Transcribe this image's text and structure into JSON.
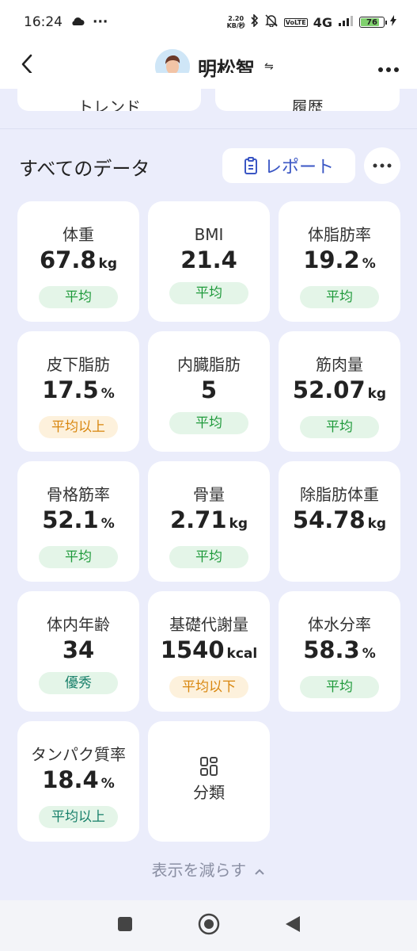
{
  "status_bar": {
    "time": "16:24",
    "net_speed_top": "2.20",
    "net_speed_bottom": "KB/秒",
    "network": "4G",
    "lte": "VoLTE",
    "battery": "76"
  },
  "header": {
    "user_name": "明松智",
    "switch_symbol": "⇋"
  },
  "top_cards": {
    "trend_label": "トレンド",
    "history_label": "履歴"
  },
  "section": {
    "title": "すべてのデータ",
    "report_label": "レポート"
  },
  "metrics": [
    {
      "label": "体重",
      "value": "67.8",
      "unit": "kg",
      "status": "平均",
      "status_color": "#1f9a3b"
    },
    {
      "label": "BMI",
      "value": "21.4",
      "unit": "",
      "status": "平均",
      "status_color": "#1f9a3b"
    },
    {
      "label": "体脂肪率",
      "value": "19.2",
      "unit": "%",
      "status": "平均",
      "status_color": "#1f9a3b"
    },
    {
      "label": "皮下脂肪",
      "value": "17.5",
      "unit": "%",
      "status": "平均以上",
      "status_color": "#d8860e"
    },
    {
      "label": "内臓脂肪",
      "value": "5",
      "unit": "",
      "status": "平均",
      "status_color": "#1f9a3b"
    },
    {
      "label": "筋肉量",
      "value": "52.07",
      "unit": "kg",
      "status": "平均",
      "status_color": "#1f9a3b"
    },
    {
      "label": "骨格筋率",
      "value": "52.1",
      "unit": "%",
      "status": "平均",
      "status_color": "#1f9a3b"
    },
    {
      "label": "骨量",
      "value": "2.71",
      "unit": "kg",
      "status": "平均",
      "status_color": "#1f9a3b"
    },
    {
      "label": "除脂肪体重",
      "value": "54.78",
      "unit": "kg",
      "status": "",
      "status_color": ""
    },
    {
      "label": "体内年齢",
      "value": "34",
      "unit": "",
      "status": "優秀",
      "status_color": "#18806a"
    },
    {
      "label": "基礎代謝量",
      "value": "1540",
      "unit": "kcal",
      "status": "平均以下",
      "status_color": "#d8860e"
    },
    {
      "label": "体水分率",
      "value": "58.3",
      "unit": "%",
      "status": "平均",
      "status_color": "#1f9a3b"
    },
    {
      "label": "タンパク質率",
      "value": "18.4",
      "unit": "%",
      "status": "平均以上",
      "status_color": "#18806a"
    }
  ],
  "classify": {
    "label": "分類"
  },
  "footer": {
    "show_less": "表示を減らす"
  },
  "colors": {
    "background": "#ebedfb",
    "accent": "#3a56c4",
    "status_green": "#1f9a3b",
    "status_orange": "#d8860e"
  }
}
